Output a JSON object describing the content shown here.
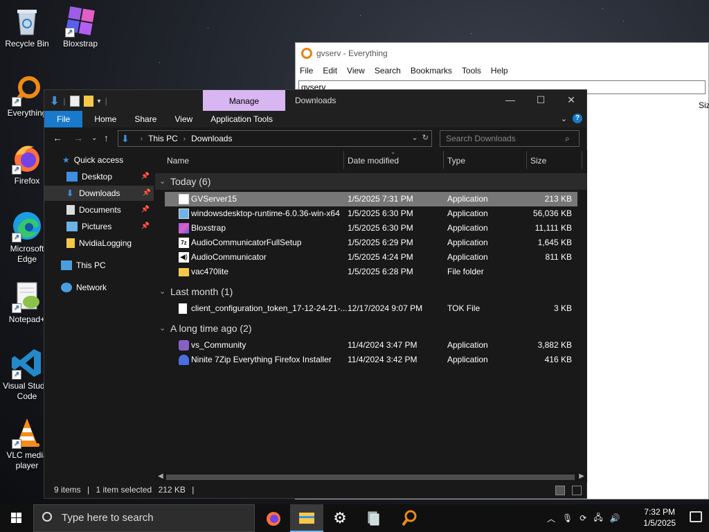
{
  "desktop": {
    "icons": [
      {
        "label": "Recycle Bin",
        "icon": "recycle-bin-icon"
      },
      {
        "label": "Bloxstrap",
        "icon": "bloxstrap-icon"
      },
      {
        "label": "Everything",
        "icon": "everything-icon"
      },
      {
        "label": "Firefox",
        "icon": "firefox-icon"
      },
      {
        "label": "Microsoft Edge",
        "icon": "edge-icon"
      },
      {
        "label": "Notepad+",
        "icon": "notepad-plus-icon"
      },
      {
        "label": "Visual Studio Code",
        "icon": "vscode-icon"
      },
      {
        "label": "VLC media player",
        "icon": "vlc-icon"
      }
    ]
  },
  "everything": {
    "title": "gvserv - Everything",
    "menu": [
      "File",
      "Edit",
      "View",
      "Search",
      "Bookmarks",
      "Tools",
      "Help"
    ],
    "search_value": "gvserv",
    "col_size": "Size"
  },
  "explorer": {
    "title": "Downloads",
    "manage_label": "Manage",
    "ribbon_tabs": [
      "File",
      "Home",
      "Share",
      "View",
      "Application Tools"
    ],
    "address": {
      "segments": [
        "This PC",
        "Downloads"
      ]
    },
    "search_placeholder": "Search Downloads",
    "nav": {
      "quick_access": "Quick access",
      "items": [
        "Desktop",
        "Downloads",
        "Documents",
        "Pictures",
        "NvidiaLogging"
      ],
      "this_pc": "This PC",
      "network": "Network"
    },
    "columns": {
      "name": "Name",
      "date": "Date modified",
      "type": "Type",
      "size": "Size"
    },
    "groups": [
      {
        "label": "Today (6)",
        "files": [
          {
            "name": "GVServer15",
            "date": "1/5/2025 7:31 PM",
            "type": "Application",
            "size": "213 KB",
            "icon": "app-icon",
            "selected": true
          },
          {
            "name": "windowsdesktop-runtime-6.0.36-win-x64",
            "date": "1/5/2025 6:30 PM",
            "type": "Application",
            "size": "56,036 KB",
            "icon": "installer-icon"
          },
          {
            "name": "Bloxstrap",
            "date": "1/5/2025 6:30 PM",
            "type": "Application",
            "size": "11,111 KB",
            "icon": "bloxstrap-icon"
          },
          {
            "name": "AudioCommunicatorFullSetup",
            "date": "1/5/2025 6:29 PM",
            "type": "Application",
            "size": "1,645 KB",
            "icon": "7zip-icon"
          },
          {
            "name": "AudioCommunicator",
            "date": "1/5/2025 4:24 PM",
            "type": "Application",
            "size": "811 KB",
            "icon": "speaker-icon"
          },
          {
            "name": "vac470lite",
            "date": "1/5/2025 6:28 PM",
            "type": "File folder",
            "size": "",
            "icon": "folder-icon"
          }
        ]
      },
      {
        "label": "Last month (1)",
        "files": [
          {
            "name": "client_configuration_token_17-12-24-21-...",
            "date": "12/17/2024 9:07 PM",
            "type": "TOK File",
            "size": "3 KB",
            "icon": "file-icon"
          }
        ]
      },
      {
        "label": "A long time ago (2)",
        "files": [
          {
            "name": "vs_Community",
            "date": "11/4/2024 3:47 PM",
            "type": "Application",
            "size": "3,882 KB",
            "icon": "visual-studio-icon"
          },
          {
            "name": "Ninite 7Zip Everything Firefox Installer",
            "date": "11/4/2024 3:42 PM",
            "type": "Application",
            "size": "416 KB",
            "icon": "ninite-icon"
          }
        ]
      }
    ],
    "status": {
      "count": "9 items",
      "selected": "1 item selected",
      "size": "212 KB"
    }
  },
  "taskbar": {
    "search_placeholder": "Type here to search",
    "time": "7:32 PM",
    "date": "1/5/2025"
  }
}
